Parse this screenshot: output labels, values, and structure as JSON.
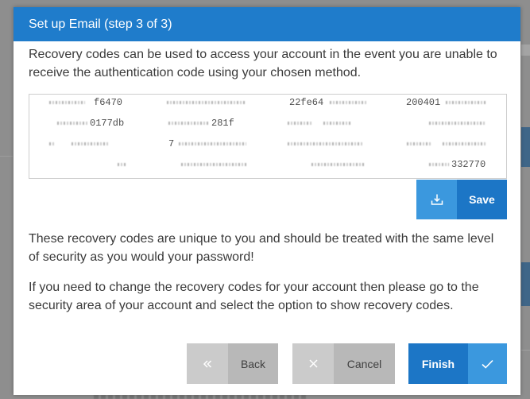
{
  "dialog": {
    "title": "Set up Email (step 3 of 3)",
    "intro": "Recovery codes can be used to access your account in the event you are unable to receive the authentication code using your chosen method.",
    "codes": [
      "f6470",
      "22fe64",
      "200401",
      "0177db",
      "281f",
      "7",
      "332770"
    ],
    "save_label": "Save",
    "notice": "These recovery codes are unique to you and should be treated with the same level of security as you would your password!",
    "change_info": "If you need to change the recovery codes for your account then please go to the security area of your account and select the option to show recovery codes.",
    "back_label": "Back",
    "cancel_label": "Cancel",
    "finish_label": "Finish"
  },
  "icons": {
    "save": "download-icon",
    "back": "double-chevron-left-icon",
    "cancel": "close-icon",
    "finish": "check-icon"
  },
  "colors": {
    "header": "#1f7ccb",
    "primary_dark": "#1c76c6",
    "primary_light": "#3b98de",
    "button_grey_light": "#cbcbcb",
    "button_grey": "#b8b8b8",
    "backdrop": "#8e8e8e"
  }
}
